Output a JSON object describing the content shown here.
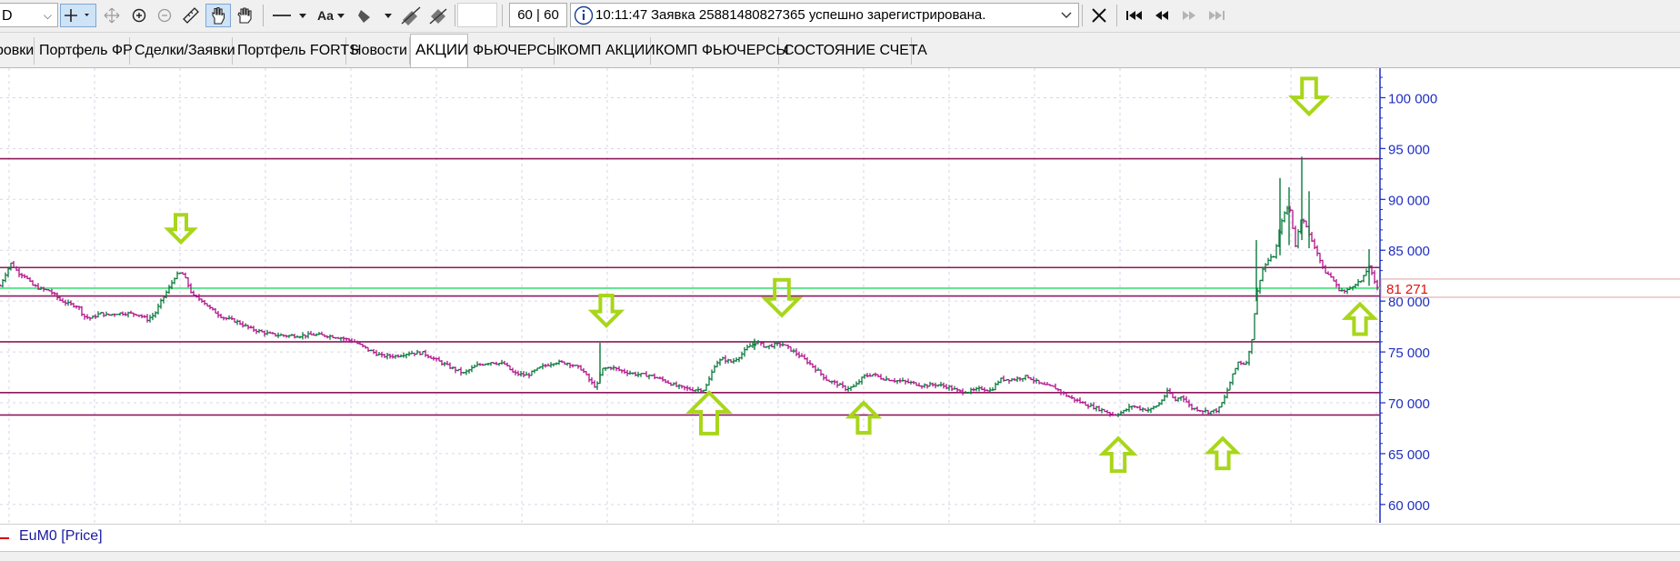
{
  "toolbar": {
    "interval_value": "D",
    "counter": "60 | 60",
    "status_time": "10:11:47",
    "status_message": "Заявка 25881480827365 успешно зарегистрирована.",
    "font_label": "Aa"
  },
  "tabs": [
    {
      "label": "ровки"
    },
    {
      "label": "Портфель ФР"
    },
    {
      "label": "Сделки/Заявки"
    },
    {
      "label": "Портфель FORTS"
    },
    {
      "label": "Новости"
    },
    {
      "label": "АКЦИИ",
      "active": true
    },
    {
      "label": "ФЬЮЧЕРСЫ"
    },
    {
      "label": "КОМП АКЦИИ"
    },
    {
      "label": "КОМП ФЬЮЧЕРСЫ"
    },
    {
      "label": "СОСТОЯНИЕ СЧЕТА"
    }
  ],
  "legend": {
    "series": "EuM0 [Price]"
  },
  "colors": {
    "candle_up": "#0a7a3c",
    "candle_down": "#b0148c",
    "level_line": "#8b1a5c",
    "current_price_line": "#59e389",
    "arrow": "#a8d61a",
    "axis": "#1f2fbf",
    "price_label": "#e01010"
  },
  "chart_data": {
    "type": "ohlc",
    "y_axis": {
      "tick_labels": [
        "100 000",
        "95 000",
        "90 000",
        "85 000",
        "80 000",
        "75 000",
        "70 000",
        "65 000",
        "60 000"
      ],
      "ticks": [
        100000,
        95000,
        90000,
        85000,
        80000,
        75000,
        70000,
        65000,
        60000
      ],
      "range": [
        58200,
        102900
      ]
    },
    "current_price": 81271,
    "current_price_label": "81 271",
    "horizontal_levels": [
      94000,
      83300,
      80500,
      76000,
      71000,
      68800
    ],
    "price_path": [
      [
        0,
        81500
      ],
      [
        5,
        82500
      ],
      [
        12,
        83700
      ],
      [
        20,
        82800
      ],
      [
        27,
        82500
      ],
      [
        35,
        81600
      ],
      [
        44,
        81200
      ],
      [
        55,
        81000
      ],
      [
        66,
        80100
      ],
      [
        76,
        79700
      ],
      [
        86,
        79500
      ],
      [
        92,
        78500
      ],
      [
        100,
        78300
      ],
      [
        110,
        78800
      ],
      [
        118,
        78600
      ],
      [
        128,
        78800
      ],
      [
        140,
        78800
      ],
      [
        152,
        78700
      ],
      [
        162,
        78200
      ],
      [
        170,
        78700
      ],
      [
        178,
        80100
      ],
      [
        186,
        81300
      ],
      [
        193,
        82500
      ],
      [
        200,
        82800
      ],
      [
        205,
        82000
      ],
      [
        212,
        80500
      ],
      [
        222,
        80100
      ],
      [
        232,
        79200
      ],
      [
        245,
        78400
      ],
      [
        260,
        78000
      ],
      [
        275,
        77300
      ],
      [
        290,
        76900
      ],
      [
        300,
        76700
      ],
      [
        315,
        76600
      ],
      [
        330,
        76600
      ],
      [
        345,
        76700
      ],
      [
        360,
        76600
      ],
      [
        375,
        76400
      ],
      [
        390,
        76000
      ],
      [
        405,
        75200
      ],
      [
        420,
        74600
      ],
      [
        435,
        74600
      ],
      [
        450,
        74900
      ],
      [
        465,
        74900
      ],
      [
        480,
        74200
      ],
      [
        495,
        73500
      ],
      [
        510,
        72900
      ],
      [
        525,
        73700
      ],
      [
        540,
        74000
      ],
      [
        555,
        73800
      ],
      [
        565,
        72900
      ],
      [
        580,
        72700
      ],
      [
        595,
        73500
      ],
      [
        610,
        74000
      ],
      [
        625,
        73900
      ],
      [
        640,
        73300
      ],
      [
        650,
        72000
      ],
      [
        656,
        71500
      ],
      [
        662,
        73300
      ],
      [
        672,
        73500
      ],
      [
        685,
        73100
      ],
      [
        700,
        72800
      ],
      [
        715,
        72700
      ],
      [
        730,
        72200
      ],
      [
        745,
        71600
      ],
      [
        760,
        71300
      ],
      [
        775,
        71300
      ],
      [
        780,
        72300
      ],
      [
        787,
        73900
      ],
      [
        795,
        74300
      ],
      [
        805,
        74000
      ],
      [
        815,
        74700
      ],
      [
        822,
        75400
      ],
      [
        832,
        76000
      ],
      [
        842,
        75500
      ],
      [
        852,
        75700
      ],
      [
        860,
        75800
      ],
      [
        870,
        75200
      ],
      [
        880,
        74600
      ],
      [
        890,
        73900
      ],
      [
        900,
        73100
      ],
      [
        910,
        72200
      ],
      [
        920,
        71900
      ],
      [
        930,
        71400
      ],
      [
        940,
        71600
      ],
      [
        950,
        72600
      ],
      [
        960,
        72800
      ],
      [
        970,
        72400
      ],
      [
        985,
        72200
      ],
      [
        1000,
        72000
      ],
      [
        1015,
        71700
      ],
      [
        1030,
        71800
      ],
      [
        1045,
        71500
      ],
      [
        1055,
        71100
      ],
      [
        1065,
        71100
      ],
      [
        1080,
        71400
      ],
      [
        1090,
        71200
      ],
      [
        1100,
        72300
      ],
      [
        1115,
        72300
      ],
      [
        1130,
        72600
      ],
      [
        1145,
        71800
      ],
      [
        1160,
        71500
      ],
      [
        1175,
        70600
      ],
      [
        1190,
        70000
      ],
      [
        1205,
        69500
      ],
      [
        1215,
        69200
      ],
      [
        1225,
        68800
      ],
      [
        1235,
        69100
      ],
      [
        1245,
        69700
      ],
      [
        1255,
        69400
      ],
      [
        1265,
        69300
      ],
      [
        1275,
        69900
      ],
      [
        1285,
        71200
      ],
      [
        1292,
        70200
      ],
      [
        1300,
        70700
      ],
      [
        1310,
        69500
      ],
      [
        1320,
        69300
      ],
      [
        1330,
        69100
      ],
      [
        1340,
        69300
      ],
      [
        1347,
        70500
      ],
      [
        1355,
        72500
      ],
      [
        1362,
        74000
      ],
      [
        1370,
        73800
      ],
      [
        1376,
        75500
      ],
      [
        1382,
        80500
      ],
      [
        1388,
        83000
      ],
      [
        1395,
        84000
      ],
      [
        1402,
        84500
      ],
      [
        1410,
        88000
      ],
      [
        1418,
        89500
      ],
      [
        1425,
        85500
      ],
      [
        1432,
        88500
      ],
      [
        1440,
        86500
      ],
      [
        1448,
        85000
      ],
      [
        1456,
        83000
      ],
      [
        1465,
        82300
      ],
      [
        1472,
        81200
      ],
      [
        1480,
        80900
      ],
      [
        1490,
        81700
      ],
      [
        1498,
        82000
      ],
      [
        1506,
        83500
      ],
      [
        1512,
        81800
      ],
      [
        1516,
        81200
      ]
    ],
    "spikes": [
      [
        1382,
        86000,
        80000
      ],
      [
        1408,
        92100,
        84500
      ],
      [
        1418,
        91200,
        85500
      ],
      [
        1432,
        94200,
        86000
      ],
      [
        1440,
        90800,
        85200
      ],
      [
        1506,
        85100,
        81500
      ],
      [
        660,
        75900,
        72000
      ],
      [
        830,
        76300,
        75200
      ]
    ],
    "arrows": [
      {
        "x": 199,
        "y": 85800,
        "dir": "down",
        "size": 1
      },
      {
        "x": 667,
        "y": 77600,
        "dir": "down",
        "size": 1.1
      },
      {
        "x": 860,
        "y": 78600,
        "dir": "down",
        "size": 1.3
      },
      {
        "x": 1440,
        "y": 98400,
        "dir": "down",
        "size": 1.3
      },
      {
        "x": 780,
        "y": 71000,
        "dir": "up",
        "size": 1.5
      },
      {
        "x": 950,
        "y": 70000,
        "dir": "up",
        "size": 1.1
      },
      {
        "x": 1230,
        "y": 66500,
        "dir": "up",
        "size": 1.2
      },
      {
        "x": 1345,
        "y": 66500,
        "dir": "up",
        "size": 1.1
      },
      {
        "x": 1496,
        "y": 79700,
        "dir": "up",
        "size": 1.1
      }
    ]
  }
}
